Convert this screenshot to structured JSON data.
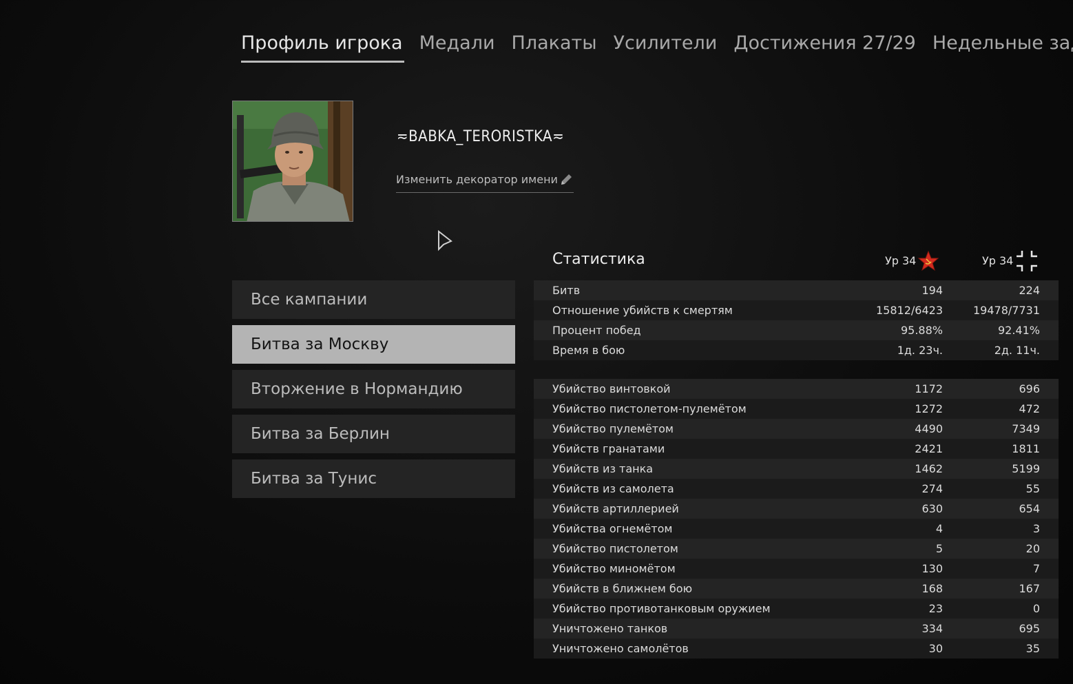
{
  "tabs": [
    {
      "label": "Профиль игрока",
      "active": true
    },
    {
      "label": "Медали"
    },
    {
      "label": "Плакаты"
    },
    {
      "label": "Усилители"
    },
    {
      "label": "Достижения 27/29"
    },
    {
      "label": "Недельные задачи"
    }
  ],
  "profile": {
    "player_name": "≂BABKA_TERORISTKA≂",
    "decorator_label": "Изменить декоратор имени",
    "avatar_icon": "soldier-portrait"
  },
  "campaigns": [
    {
      "label": "Все кампании"
    },
    {
      "label": "Битва за Москву",
      "active": true
    },
    {
      "label": "Вторжение в Нормандию"
    },
    {
      "label": "Битва за Берлин"
    },
    {
      "label": "Битва за Тунис"
    }
  ],
  "stats": {
    "title": "Статистика",
    "level_allies": "Ур 34",
    "level_axis": "Ур 34",
    "allies_icon": "red-star-icon",
    "axis_icon": "balkenkreuz-icon",
    "summary": [
      {
        "label": "Битв",
        "v1": "194",
        "v2": "224"
      },
      {
        "label": "Отношение убийств к смертям",
        "v1": "15812/6423",
        "v2": "19478/7731"
      },
      {
        "label": "Процент побед",
        "v1": "95.88%",
        "v2": "92.41%"
      },
      {
        "label": "Время в бою",
        "v1": "1д. 23ч.",
        "v2": "2д. 11ч."
      }
    ],
    "kills": [
      {
        "label": "Убийство винтовкой",
        "v1": "1172",
        "v2": "696"
      },
      {
        "label": "Убийство пистолетом-пулемётом",
        "v1": "1272",
        "v2": "472"
      },
      {
        "label": "Убийство пулемётом",
        "v1": "4490",
        "v2": "7349"
      },
      {
        "label": "Убийств гранатами",
        "v1": "2421",
        "v2": "1811"
      },
      {
        "label": "Убийств из танка",
        "v1": "1462",
        "v2": "5199"
      },
      {
        "label": "Убийств из самолета",
        "v1": "274",
        "v2": "55"
      },
      {
        "label": "Убийств артиллерией",
        "v1": "630",
        "v2": "654"
      },
      {
        "label": "Убийства огнемётом",
        "v1": "4",
        "v2": "3"
      },
      {
        "label": "Убийство пистолетом",
        "v1": "5",
        "v2": "20"
      },
      {
        "label": "Убийство миномётом",
        "v1": "130",
        "v2": "7"
      },
      {
        "label": "Убийств в ближнем бою",
        "v1": "168",
        "v2": "167"
      },
      {
        "label": "Убийство противотанковым оружием",
        "v1": "23",
        "v2": "0"
      },
      {
        "label": "Уничтожено танков",
        "v1": "334",
        "v2": "695"
      },
      {
        "label": "Уничтожено самолётов",
        "v1": "30",
        "v2": "35"
      }
    ]
  },
  "colors": {
    "background": "#0c0c0c",
    "row_odd": "#242424",
    "row_even": "#1b1b1b",
    "active_campaign": "#b4b4b4",
    "soviet_red": "#d32a1e"
  }
}
